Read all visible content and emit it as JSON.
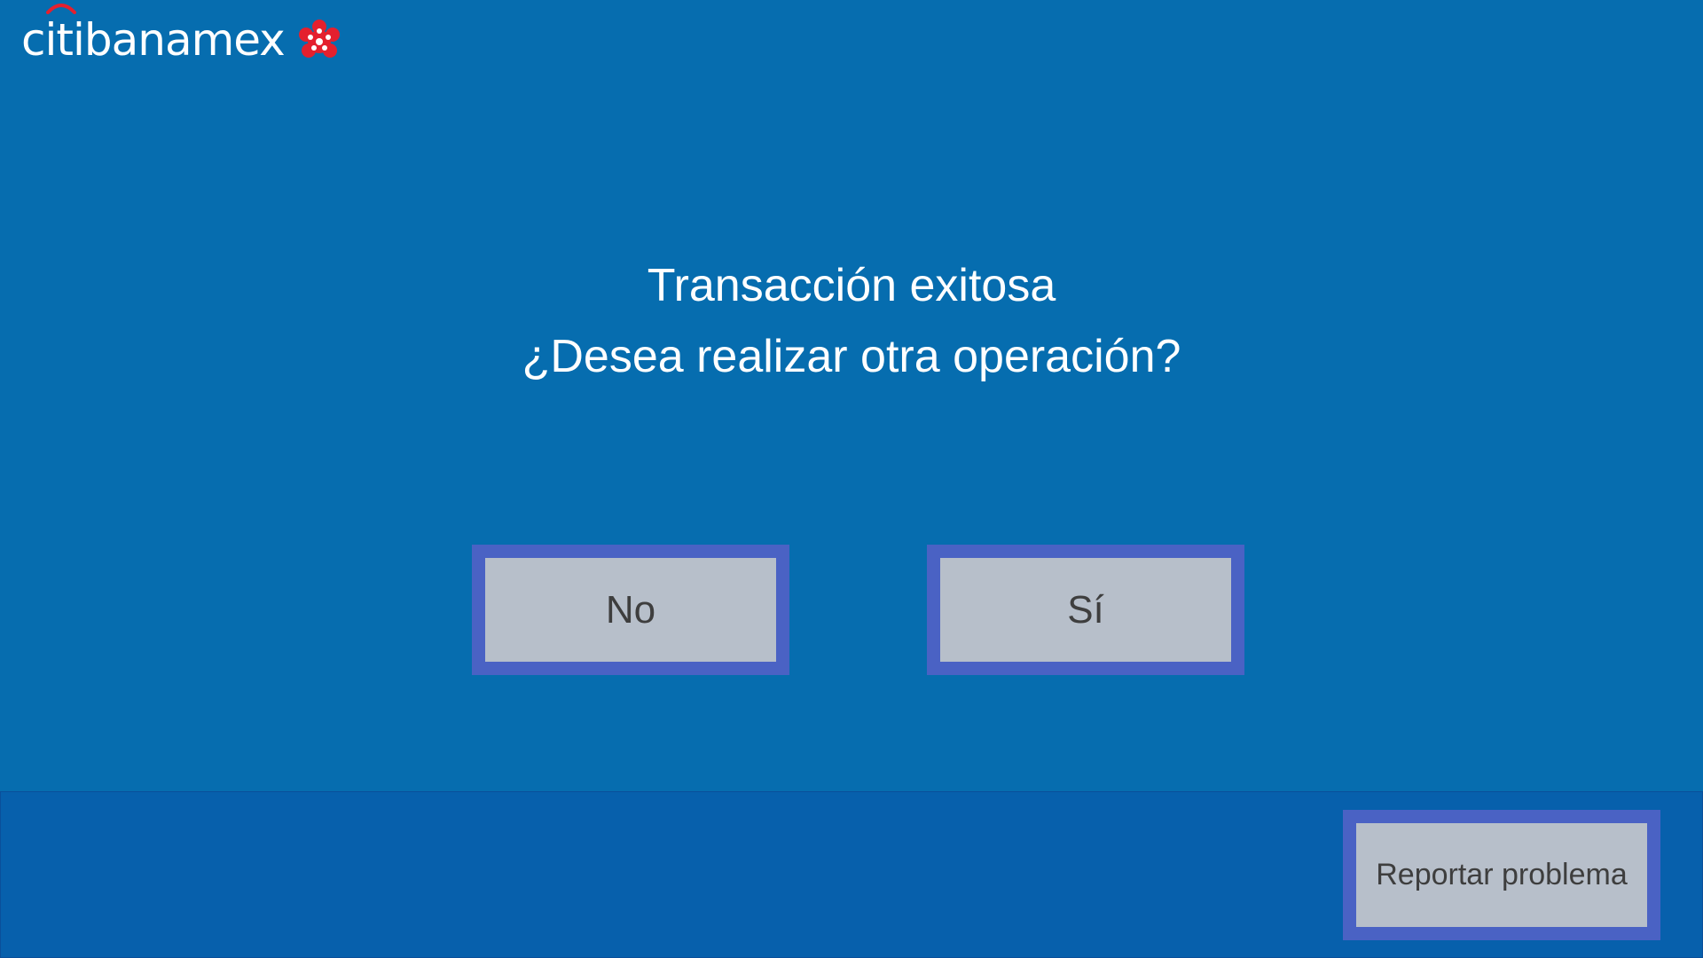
{
  "brand": {
    "name": "citibanamex",
    "logo_icon": "banamex-flower-icon",
    "arc_color": "#e4202e",
    "flower_color": "#e4202e"
  },
  "message": {
    "line1": "Transacción exitosa",
    "line2": "¿Desea realizar otra operación?"
  },
  "buttons": {
    "no_label": "No",
    "yes_label": "Sí"
  },
  "footer": {
    "report_label": "Reportar problema"
  },
  "colors": {
    "background": "#066daf",
    "footer": "#0760ac",
    "button_border": "#4a62c4",
    "button_fill": "#b7bfca",
    "button_text": "#3e3e3e"
  }
}
